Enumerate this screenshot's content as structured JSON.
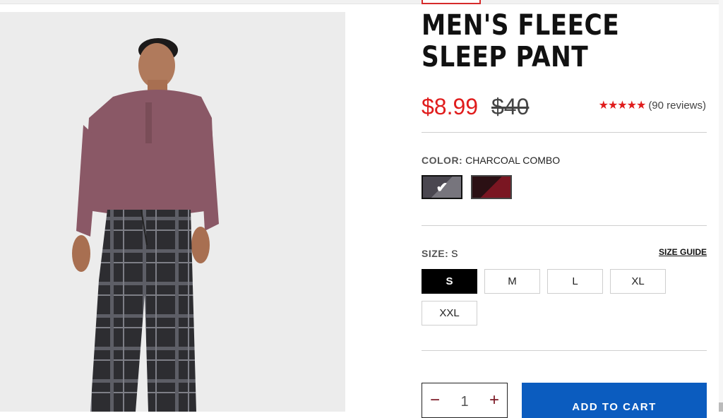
{
  "product": {
    "title": "MEN'S FLEECE SLEEP PANT",
    "sale_price": "$8.99",
    "regular_price": "$40",
    "rating_stars": "★★★★★",
    "review_count": "(90 reviews)"
  },
  "color": {
    "label": "COLOR:",
    "selected": "CHARCOAL COMBO",
    "options": [
      {
        "name": "charcoal-combo",
        "colors": [
          "#4a4750",
          "#77757d"
        ],
        "selected": true
      },
      {
        "name": "red-combo",
        "colors": [
          "#2b1014",
          "#7a1622"
        ],
        "selected": false
      }
    ],
    "check_glyph": "✔"
  },
  "size": {
    "label": "SIZE:",
    "selected": "S",
    "guide_label": "SIZE GUIDE",
    "options": [
      "S",
      "M",
      "L",
      "XL",
      "XXL"
    ]
  },
  "cart": {
    "quantity": "1",
    "minus_glyph": "−",
    "plus_glyph": "+",
    "add_label": "ADD TO CART",
    "button_color": "#0b5cbf"
  },
  "colors": {
    "sale": "#e01c1c",
    "accent_red": "#d62b2b"
  }
}
